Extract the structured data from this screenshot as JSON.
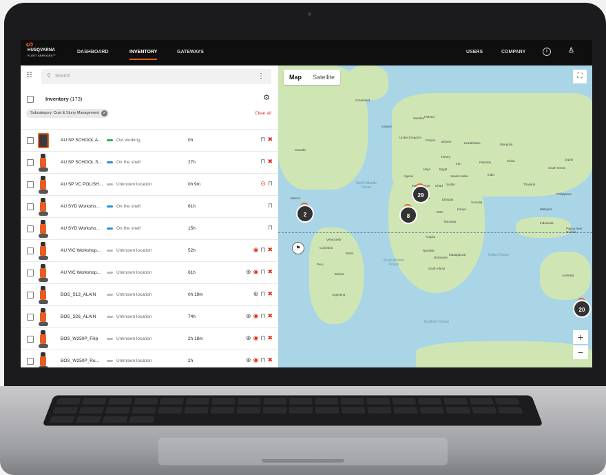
{
  "nav": {
    "brand": "HUSQVARNA",
    "brand_sub": "FLEET SERVICES™",
    "tabs": [
      "DASHBOARD",
      "INVENTORY",
      "GATEWAYS"
    ],
    "active_tab": "INVENTORY",
    "right_links": [
      "USERS",
      "COMPANY"
    ],
    "icons": [
      "info-icon",
      "user-icon"
    ]
  },
  "left": {
    "search_placeholder": "Search",
    "inventory_title": "Inventory",
    "inventory_count": "(173)",
    "filter_chip": "Subcategory: Dust & Slurry Management",
    "clear_all": "Clear all",
    "rows": [
      {
        "name": "AU SP SCHOOL A...",
        "status": "Out working",
        "status_color": "#2bb04a",
        "hours": "0h",
        "thumb": "box",
        "actions": [
          "lock-icon",
          "wrench-icon"
        ]
      },
      {
        "name": "AU SP SCHOOL S...",
        "status": "On the shelf",
        "status_color": "#1f8fe0",
        "hours": "27h",
        "thumb": "machine",
        "actions": [
          "lock-icon",
          "wrench-icon"
        ]
      },
      {
        "name": "AU SP VC POLISH...",
        "status": "Unknown location",
        "status_color": "#b9b9b9",
        "hours": "0h 9m",
        "thumb": "machine",
        "actions": [
          "alert-icon",
          "lock-icon"
        ]
      },
      {
        "name": "AU SYD Worksho...",
        "status": "On the shelf",
        "status_color": "#1f8fe0",
        "hours": "61h",
        "thumb": "machine",
        "actions": [
          "lock-icon"
        ]
      },
      {
        "name": "AU SYD Worksho...",
        "status": "On the shelf",
        "status_color": "#1f8fe0",
        "hours": "15h",
        "thumb": "machine",
        "actions": [
          "lock-icon"
        ]
      },
      {
        "name": "AU VIC Workshop...",
        "status": "Unknown location",
        "status_color": "#b9b9b9",
        "hours": "52h",
        "thumb": "machine",
        "actions": [
          "eye-icon",
          "lock-icon",
          "wrench-icon"
        ]
      },
      {
        "name": "AU VIC Workshop...",
        "status": "Unknown location",
        "status_color": "#b9b9b9",
        "hours": "61h",
        "thumb": "machine",
        "actions": [
          "clock-icon",
          "eye-icon",
          "lock-icon",
          "wrench-icon"
        ]
      },
      {
        "name": "BOS_S13_ALAIN",
        "status": "Unknown location",
        "status_color": "#b9b9b9",
        "hours": "0h 19m",
        "thumb": "machine",
        "actions": [
          "clock-icon",
          "lock-icon",
          "wrench-icon"
        ]
      },
      {
        "name": "BOS_S26_ALAIN",
        "status": "Unknown location",
        "status_color": "#b9b9b9",
        "hours": "74h",
        "thumb": "machine",
        "actions": [
          "clock-icon",
          "eye-icon",
          "lock-icon",
          "wrench-icon"
        ]
      },
      {
        "name": "BOS_W250P_Filip",
        "status": "Unknown location",
        "status_color": "#b9b9b9",
        "hours": "2h 18m",
        "thumb": "machine",
        "actions": [
          "clock-icon",
          "eye-icon",
          "lock-icon",
          "wrench-icon"
        ]
      },
      {
        "name": "BOS_W250P_Ru...",
        "status": "Unknown location",
        "status_color": "#b9b9b9",
        "hours": "2h",
        "thumb": "machine",
        "actions": [
          "clock-icon",
          "eye-icon",
          "lock-icon",
          "wrench-icon"
        ]
      }
    ]
  },
  "map": {
    "tabs": [
      "Map",
      "Satellite"
    ],
    "active_tab": "Map",
    "zoom_in": "+",
    "zoom_out": "−",
    "clusters": [
      {
        "count": "2",
        "region": "north-america"
      },
      {
        "count": "29",
        "region": "northern-europe"
      },
      {
        "count": "8",
        "region": "southern-europe"
      },
      {
        "count": "20",
        "region": "australia"
      }
    ],
    "labels": [
      "Greenland",
      "Iceland",
      "Sweden",
      "Finland",
      "United Kingdom",
      "Poland",
      "Ukraine",
      "Kazakhstan",
      "Mongolia",
      "China",
      "Turkey",
      "Iran",
      "Pakistan",
      "India",
      "Libya",
      "Egypt",
      "Algeria",
      "Saudi Arabia",
      "Mali",
      "Niger",
      "Chad",
      "Sudan",
      "Nigeria",
      "Ethiopia",
      "DRC",
      "Tanzania",
      "Angola",
      "Namibia",
      "Botswana",
      "South Africa",
      "Madagascar",
      "Indonesia",
      "Papua New Guinea",
      "Australia",
      "Venezuela",
      "Colombia",
      "Peru",
      "Brazil",
      "Bolivia",
      "Argentina",
      "Mexico",
      "Canada",
      "Thailand",
      "South Korea",
      "Japan",
      "Philippines",
      "Malaysia",
      "Kenya",
      "Somalia"
    ],
    "oceans": [
      "North Atlantic Ocean",
      "South Atlantic Ocean",
      "Indian Ocean",
      "Southern Ocean"
    ]
  }
}
